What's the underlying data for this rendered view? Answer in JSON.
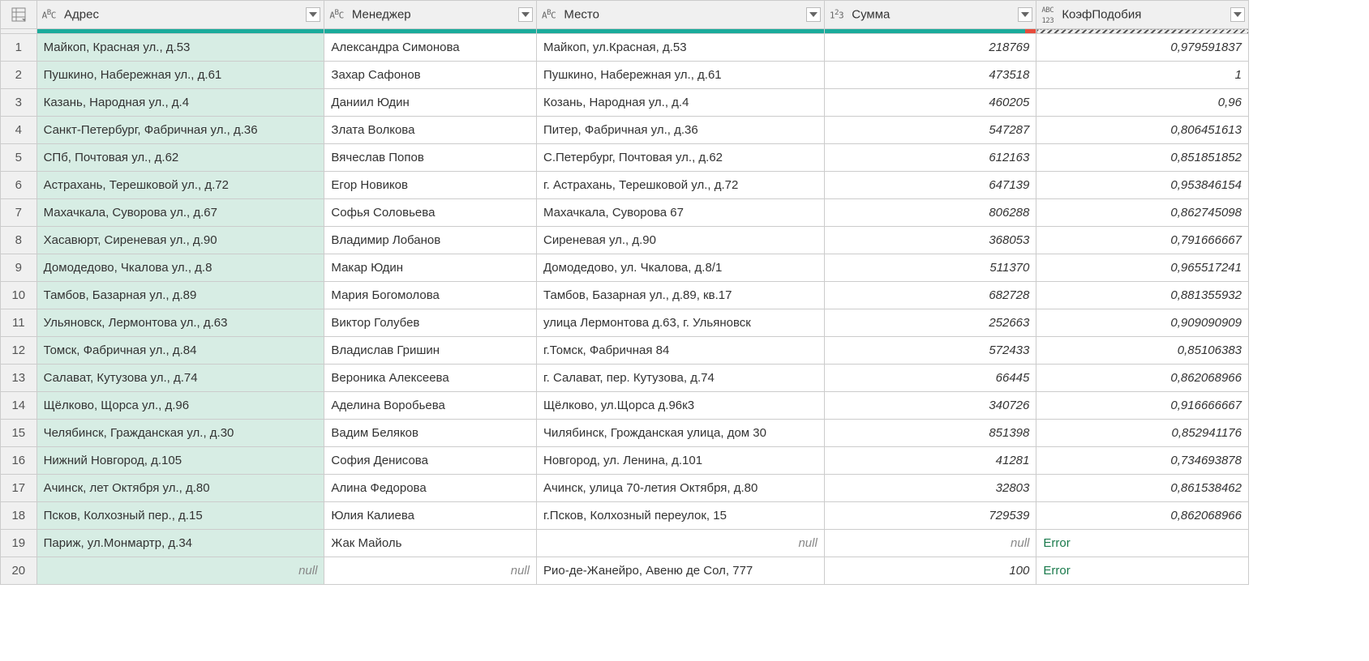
{
  "columns": {
    "address": {
      "label": "Адрес",
      "type": "ABC"
    },
    "manager": {
      "label": "Менеджер",
      "type": "ABC"
    },
    "place": {
      "label": "Место",
      "type": "ABC"
    },
    "sum": {
      "label": "Сумма",
      "type": "123"
    },
    "coef": {
      "label": "КоэфПодобия",
      "type": "ABC123"
    }
  },
  "null_label": "null",
  "error_label": "Error",
  "rows": [
    {
      "n": "1",
      "address": "Майкоп, Красная ул., д.53",
      "manager": "Александра Симонова",
      "place": "Майкоп, ул.Красная, д.53",
      "sum": "218769",
      "coef": "0,979591837"
    },
    {
      "n": "2",
      "address": "Пушкино, Набережная ул., д.61",
      "manager": "Захар Сафонов",
      "place": "Пушкино, Набережная ул., д.61",
      "sum": "473518",
      "coef": "1"
    },
    {
      "n": "3",
      "address": "Казань, Народная ул., д.4",
      "manager": "Даниил Юдин",
      "place": "Козань, Народная ул., д.4",
      "sum": "460205",
      "coef": "0,96"
    },
    {
      "n": "4",
      "address": "Санкт-Петербург, Фабричная ул., д.36",
      "manager": "Злата Волкова",
      "place": "Питер, Фабричная ул., д.36",
      "sum": "547287",
      "coef": "0,806451613"
    },
    {
      "n": "5",
      "address": "СПб, Почтовая ул., д.62",
      "manager": "Вячеслав Попов",
      "place": "С.Петербург, Почтовая ул., д.62",
      "sum": "612163",
      "coef": "0,851851852"
    },
    {
      "n": "6",
      "address": "Астрахань, Терешковой ул., д.72",
      "manager": "Егор Новиков",
      "place": "г. Астрахань, Терешковой ул., д.72",
      "sum": "647139",
      "coef": "0,953846154"
    },
    {
      "n": "7",
      "address": "Махачкала, Суворова ул., д.67",
      "manager": "Софья Соловьева",
      "place": "Махачкала, Суворова 67",
      "sum": "806288",
      "coef": "0,862745098"
    },
    {
      "n": "8",
      "address": "Хасавюрт, Сиреневая ул., д.90",
      "manager": "Владимир Лобанов",
      "place": "Сиреневая ул., д.90",
      "sum": "368053",
      "coef": "0,791666667"
    },
    {
      "n": "9",
      "address": "Домодедово, Чкалова ул., д.8",
      "manager": "Макар Юдин",
      "place": "Домодедово, ул. Чкалова, д.8/1",
      "sum": "511370",
      "coef": "0,965517241"
    },
    {
      "n": "10",
      "address": "Тамбов, Базарная ул., д.89",
      "manager": "Мария Богомолова",
      "place": "Тамбов, Базарная ул., д.89, кв.17",
      "sum": "682728",
      "coef": "0,881355932"
    },
    {
      "n": "11",
      "address": "Ульяновск, Лермонтова ул., д.63",
      "manager": "Виктор Голубев",
      "place": "улица Лермонтова д.63, г. Ульяновск",
      "sum": "252663",
      "coef": "0,909090909"
    },
    {
      "n": "12",
      "address": "Томск, Фабричная ул., д.84",
      "manager": "Владислав Гришин",
      "place": "г.Томск, Фабричная 84",
      "sum": "572433",
      "coef": "0,85106383"
    },
    {
      "n": "13",
      "address": "Салават, Кутузова ул., д.74",
      "manager": "Вероника Алексеева",
      "place": "г. Салават, пер. Кутузова, д.74",
      "sum": "66445",
      "coef": "0,862068966"
    },
    {
      "n": "14",
      "address": "Щёлково, Щорса ул., д.96",
      "manager": "Аделина Воробьева",
      "place": "Щёлково, ул.Щорса д.96к3",
      "sum": "340726",
      "coef": "0,916666667"
    },
    {
      "n": "15",
      "address": "Челябинск, Гражданская ул., д.30",
      "manager": "Вадим Беляков",
      "place": "Чилябинск, Грожданская улица, дом 30",
      "sum": "851398",
      "coef": "0,852941176"
    },
    {
      "n": "16",
      "address": "Нижний Новгород, д.105",
      "manager": "София Денисова",
      "place": "Новгород, ул. Ленина, д.101",
      "sum": "41281",
      "coef": "0,734693878"
    },
    {
      "n": "17",
      "address": "Ачинск, лет Октября ул., д.80",
      "manager": "Алина Федорова",
      "place": "Ачинск, улица 70-летия Октября, д.80",
      "sum": "32803",
      "coef": "0,861538462"
    },
    {
      "n": "18",
      "address": "Псков, Колхозный пер., д.15",
      "manager": "Юлия Калиева",
      "place": "г.Псков, Колхозный переулок, 15",
      "sum": "729539",
      "coef": "0,862068966"
    },
    {
      "n": "19",
      "address": "Париж, ул.Монмартр, д.34",
      "manager": "Жак Майоль",
      "place": null,
      "sum": null,
      "coef": "Error"
    },
    {
      "n": "20",
      "address": null,
      "manager": null,
      "place": "Рио-де-Жанейро, Авеню де Сол, 777",
      "sum": "100",
      "coef": "Error"
    }
  ]
}
